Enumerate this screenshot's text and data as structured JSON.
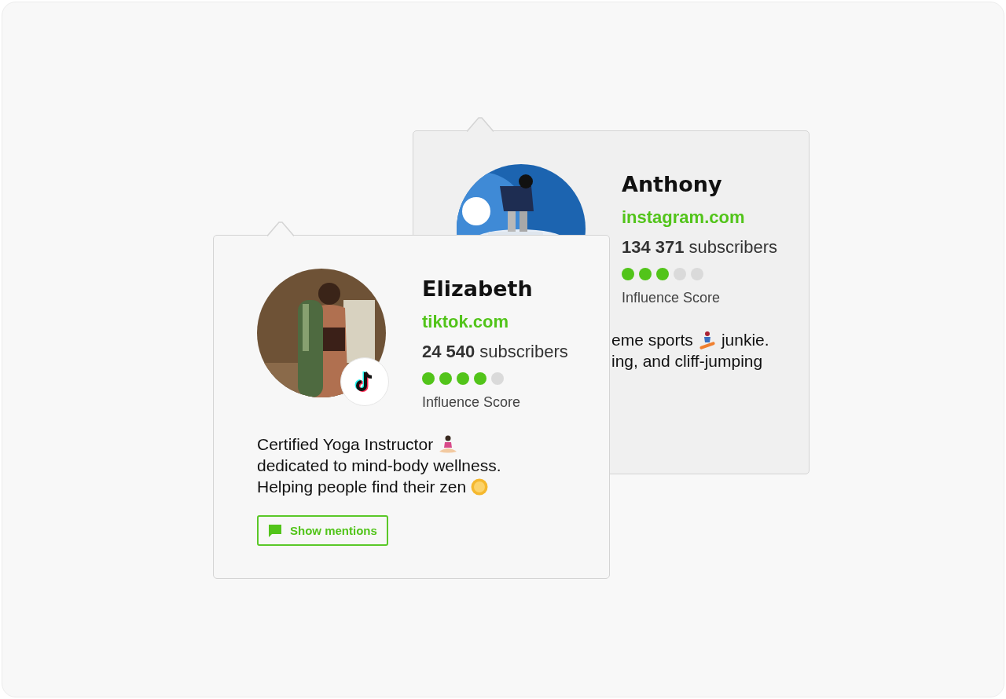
{
  "cards": [
    {
      "name": "Anthony",
      "domain": "instagram.com",
      "count": "134 371",
      "count_label": "subscribers",
      "stars": 3,
      "score_label": "Influence Score",
      "avatar": {
        "kind": "picture"
      },
      "bio": [
        [
          {
            "kind": "text",
            "text": "eme sports"
          },
          {
            "kind": "snowboarder"
          },
          {
            "kind": "text",
            "text": "junkie."
          }
        ],
        [
          {
            "kind": "text",
            "text": "ing, and cliff-jumping"
          }
        ]
      ]
    },
    {
      "name": "Elizabeth",
      "domain": "tiktok.com",
      "count": "24 540",
      "count_label": "subscribers",
      "stars": 4,
      "score_label": "Influence Score",
      "platform_badge": true,
      "avatar": {
        "kind": "picture"
      },
      "bio": [
        [
          {
            "kind": "text",
            "text": "Certified Yoga Instructor"
          },
          {
            "kind": "meditation"
          }
        ],
        [
          {
            "kind": "text",
            "text": "dedicated to mind-body wellness."
          }
        ],
        [
          {
            "kind": "text",
            "text": "Helping people find their zen"
          },
          {
            "kind": "sun"
          }
        ]
      ],
      "button": "Show mentions"
    }
  ]
}
